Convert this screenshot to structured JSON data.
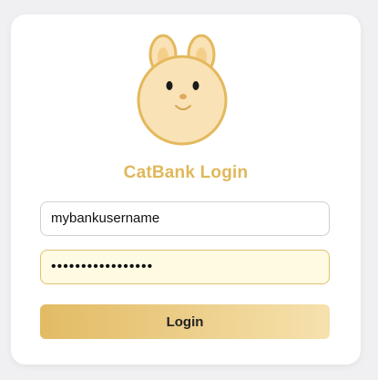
{
  "app": {
    "title": "CatBank Login"
  },
  "form": {
    "username_value": "mybankusername",
    "password_value": "•••••••••••••••••",
    "login_label": "Login"
  },
  "colors": {
    "title": "#e0b85a",
    "button_gradient_start": "#e2bb64",
    "button_gradient_end": "#f6e1ad",
    "mascot_fill": "#f9e2b5",
    "mascot_outline": "#e4b85c",
    "password_field_bg": "#fffbe3"
  },
  "icons": {
    "mascot": "cat-bear-mascot-icon"
  }
}
